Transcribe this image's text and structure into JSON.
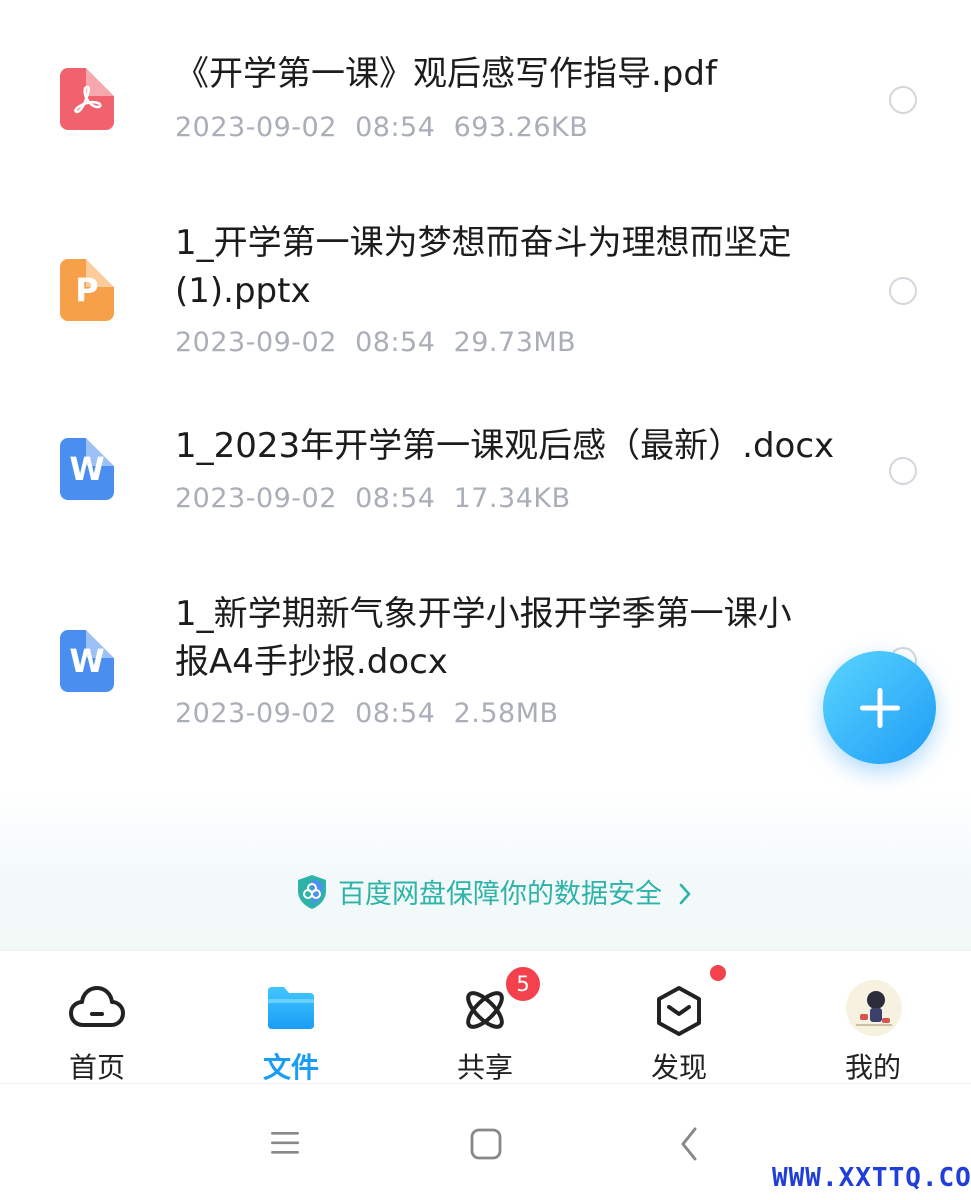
{
  "files": [
    {
      "name": "《开学第一课》观后感写作指导.pdf",
      "date": "2023-09-02",
      "time": "08:54",
      "size": "693.26KB",
      "type_icon": "pdf-file-icon",
      "type_glyph": ""
    },
    {
      "name": "1_开学第一课为梦想而奋斗为理想而坚定(1).pptx",
      "date": "2023-09-02",
      "time": "08:54",
      "size": "29.73MB",
      "type_icon": "ppt-file-icon",
      "type_glyph": "P"
    },
    {
      "name": "1_2023年开学第一课观后感（最新）.docx",
      "date": "2023-09-02",
      "time": "08:54",
      "size": "17.34KB",
      "type_icon": "word-file-icon",
      "type_glyph": "W"
    },
    {
      "name": "1_新学期新气象开学小报开学季第一课小报A4手抄报.docx",
      "date": "2023-09-02",
      "time": "08:54",
      "size": "2.58MB",
      "type_icon": "word-file-icon",
      "type_glyph": "W"
    }
  ],
  "security_banner": {
    "text": "百度网盘保障你的数据安全",
    "icon": "shield-icon",
    "arrow": "chevron-right-icon",
    "color": "#2db3a8"
  },
  "fab": {
    "icon": "plus-icon"
  },
  "bottom_nav": [
    {
      "label": "首页",
      "icon": "cloud-icon",
      "active": false
    },
    {
      "label": "文件",
      "icon": "folder-icon",
      "active": true
    },
    {
      "label": "共享",
      "icon": "atom-icon",
      "active": false,
      "badge": "5"
    },
    {
      "label": "发现",
      "icon": "cube-icon",
      "active": false,
      "dot": true
    },
    {
      "label": "我的",
      "icon": "avatar-icon",
      "active": false
    }
  ],
  "system_nav": {
    "menu": "menu-icon",
    "home": "home-square-icon",
    "back": "back-chevron-icon"
  },
  "watermark": "WWW.XXTTQ.COM",
  "colors": {
    "accent": "#1a9df5",
    "badge": "#f3414e",
    "meta": "#a9aeb8"
  }
}
